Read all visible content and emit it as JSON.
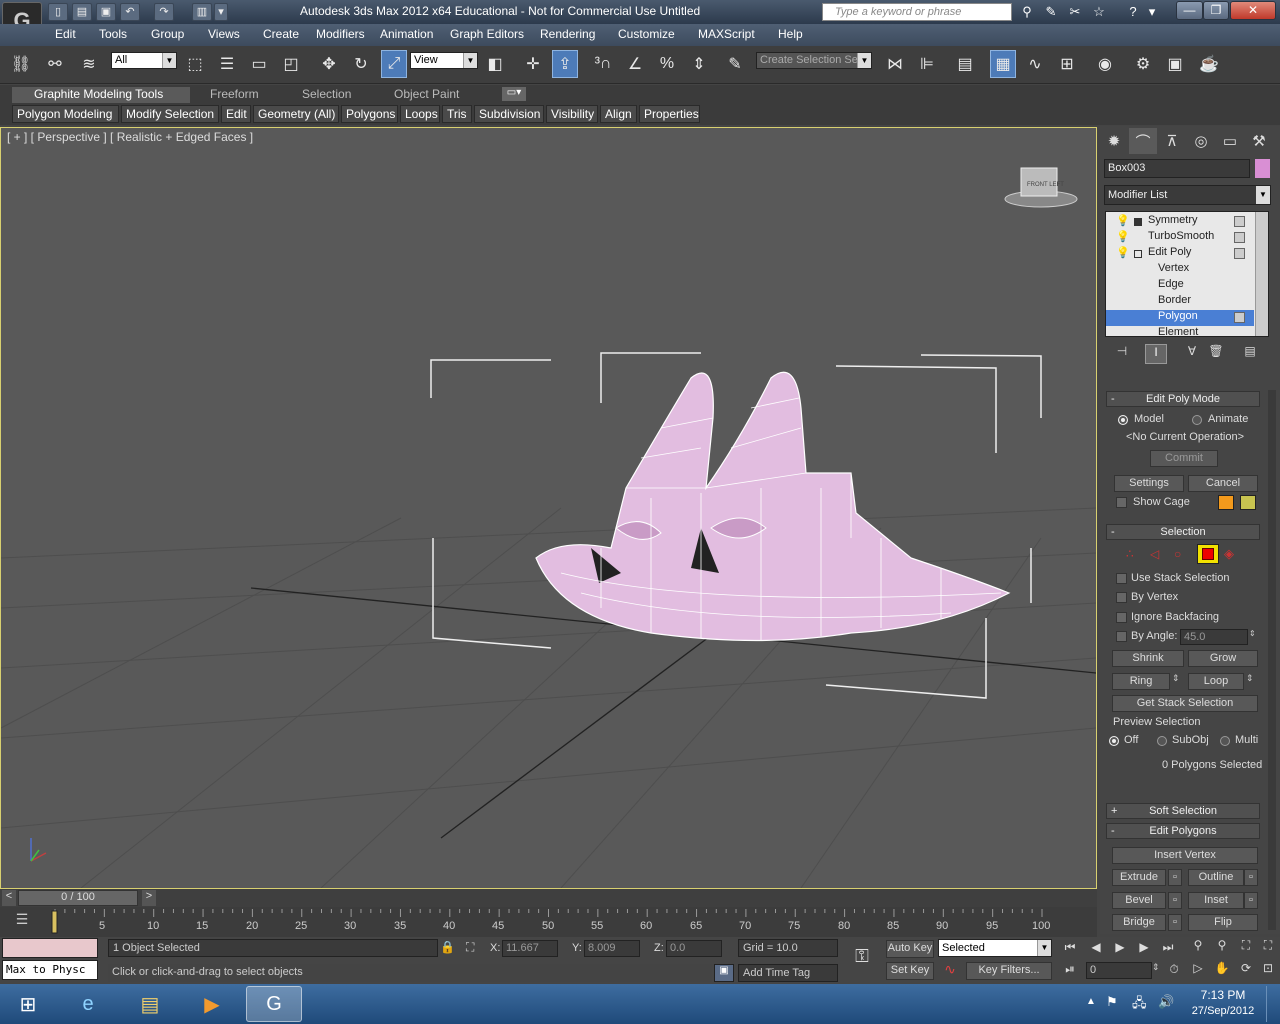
{
  "title": "Autodesk 3ds Max  2012 x64   Educational - Not for Commercial Use    Untitled",
  "search_placeholder": "Type a keyword or phrase",
  "window_controls": {
    "minimize": "—",
    "restore": "❐",
    "close": "✕"
  },
  "menu": [
    "Edit",
    "Tools",
    "Group",
    "Views",
    "Create",
    "Modifiers",
    "Animation",
    "Graph Editors",
    "Rendering",
    "Customize",
    "MAXScript",
    "Help"
  ],
  "toolbar": {
    "filter_value": "All",
    "ref_coord_value": "View",
    "selection_set_placeholder": "Create Selection Se"
  },
  "ribbon": {
    "tabs": [
      "Graphite Modeling Tools",
      "Freeform",
      "Selection",
      "Object Paint"
    ],
    "sub_tabs": [
      "Polygon Modeling",
      "Modify Selection",
      "Edit",
      "Geometry (All)",
      "Polygons",
      "Loops",
      "Tris",
      "Subdivision",
      "Visibility",
      "Align",
      "Properties"
    ]
  },
  "viewport": {
    "label": "[ + ] [ Perspective ] [ Realistic + Edged Faces ]",
    "viewcube_label": "FRONT  LEFT"
  },
  "command_panel": {
    "object_name": "Box003",
    "object_color": "#d98fd4",
    "modifier_list": "Modifier List",
    "stack": [
      "Symmetry",
      "TurboSmooth",
      "Edit Poly",
      "Vertex",
      "Edge",
      "Border",
      "Polygon",
      "Element"
    ],
    "selected_stack_item": "Polygon",
    "edit_poly_mode": {
      "header": "Edit Poly Mode",
      "model_label": "Model",
      "animate_label": "Animate",
      "operation": "<No Current Operation>",
      "commit": "Commit",
      "settings": "Settings",
      "cancel": "Cancel",
      "show_cage": "Show Cage",
      "cage_color_1": "#f39a1c",
      "cage_color_2": "#c8c450"
    },
    "selection": {
      "header": "Selection",
      "use_stack_selection": "Use Stack Selection",
      "by_vertex": "By Vertex",
      "ignore_backfacing": "Ignore Backfacing",
      "by_angle": "By Angle:",
      "angle_value": "45.0",
      "shrink": "Shrink",
      "grow": "Grow",
      "ring": "Ring",
      "loop": "Loop",
      "get_stack_selection": "Get Stack Selection",
      "preview_selection": "Preview Selection",
      "off": "Off",
      "subobj": "SubObj",
      "multi": "Multi",
      "status": "0 Polygons Selected"
    },
    "soft_selection": "Soft Selection",
    "edit_polygons": {
      "header": "Edit Polygons",
      "insert_vertex": "Insert Vertex",
      "extrude": "Extrude",
      "outline": "Outline",
      "bevel": "Bevel",
      "inset": "Inset",
      "bridge": "Bridge",
      "flip": "Flip"
    }
  },
  "timeline": {
    "frame_display": "0 / 100",
    "prev": "<",
    "next": ">",
    "ticks": [
      "5",
      "10",
      "15",
      "20",
      "25",
      "30",
      "35",
      "40",
      "45",
      "50",
      "55",
      "60",
      "65",
      "70",
      "75",
      "80",
      "85",
      "90",
      "95",
      "100"
    ]
  },
  "status": {
    "maxscript": "Max to Physc",
    "selected_count": "1 Object Selected",
    "prompt": "Click or click-and-drag to select objects",
    "x_label": "X:",
    "x_value": "11.667",
    "y_label": "Y:",
    "y_value": "8.009",
    "z_label": "Z:",
    "z_value": "0.0",
    "grid": "Grid = 10.0",
    "add_time_tag": "Add Time Tag",
    "auto_key": "Auto Key",
    "set_key": "Set Key",
    "key_mode": "Selected",
    "key_filters": "Key Filters...",
    "current_frame": "0"
  },
  "taskbar": {
    "time": "7:13 PM",
    "date": "27/Sep/2012"
  }
}
